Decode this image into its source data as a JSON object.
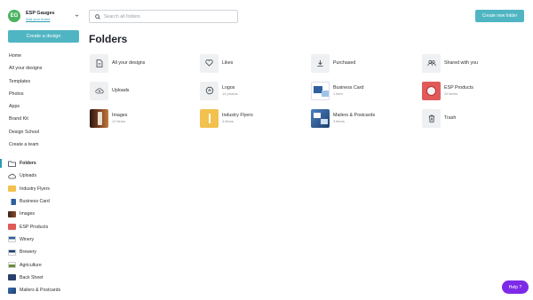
{
  "account": {
    "initials": "EG",
    "name": "ESP Gauges",
    "sub": "Add your brand"
  },
  "sidebar": {
    "create_label": "Create a design",
    "nav": [
      "Home",
      "All your designs",
      "Templates",
      "Photos",
      "Apps",
      "Brand Kit",
      "Design School",
      "Create a team"
    ],
    "folders": [
      {
        "label": "Folders",
        "icon": "folder-icon",
        "active": true
      },
      {
        "label": "Uploads",
        "icon": "cloud-icon"
      },
      {
        "label": "Industry Flyers",
        "thumb": "#f2c14e"
      },
      {
        "label": "Business Card",
        "thumb": "#2f5f9e"
      },
      {
        "label": "Images",
        "thumb": "#6b3a2a"
      },
      {
        "label": "ESP Products",
        "thumb": "#e05a5a"
      },
      {
        "label": "Winery",
        "thumb": "#2f5f9e"
      },
      {
        "label": "Brewery",
        "thumb": "#1f3f6e"
      },
      {
        "label": "Agriculture",
        "thumb": "#6a8d3c"
      },
      {
        "label": "Back Sheet",
        "thumb": "#2a3f6b"
      },
      {
        "label": "Mailers & Postcards",
        "thumb": "#3b6fb0"
      }
    ]
  },
  "search": {
    "placeholder": "Search all folders"
  },
  "header": {
    "new_folder_label": "Create new folder"
  },
  "main": {
    "title": "Folders",
    "tiles": [
      {
        "name": "All your designs",
        "icon": "document-icon"
      },
      {
        "name": "Likes",
        "icon": "heart-icon"
      },
      {
        "name": "Purchased",
        "icon": "download-icon"
      },
      {
        "name": "Shared with you",
        "icon": "people-icon"
      },
      {
        "name": "Uploads",
        "icon": "cloud-upload-icon"
      },
      {
        "name": "Logos",
        "count": "14 photos",
        "icon": "logo-thumb-icon"
      },
      {
        "name": "Business Card",
        "count": "1 item",
        "icon": "business-card-thumb"
      },
      {
        "name": "ESP Products",
        "count": "29 items",
        "icon": "esp-products-thumb"
      },
      {
        "name": "Images",
        "count": "12 items",
        "icon": "images-thumb"
      },
      {
        "name": "Industry Flyers",
        "count": "4 items",
        "icon": "industry-flyers-thumb"
      },
      {
        "name": "Mailers & Postcards",
        "count": "3 items",
        "icon": "mailers-thumb"
      },
      {
        "name": "Trash",
        "icon": "trash-icon"
      }
    ]
  },
  "help": {
    "label": "Help ?"
  },
  "colors": {
    "accent": "#4fb5c3",
    "help": "#7d2ae8",
    "avatar": "#4bb35f"
  }
}
